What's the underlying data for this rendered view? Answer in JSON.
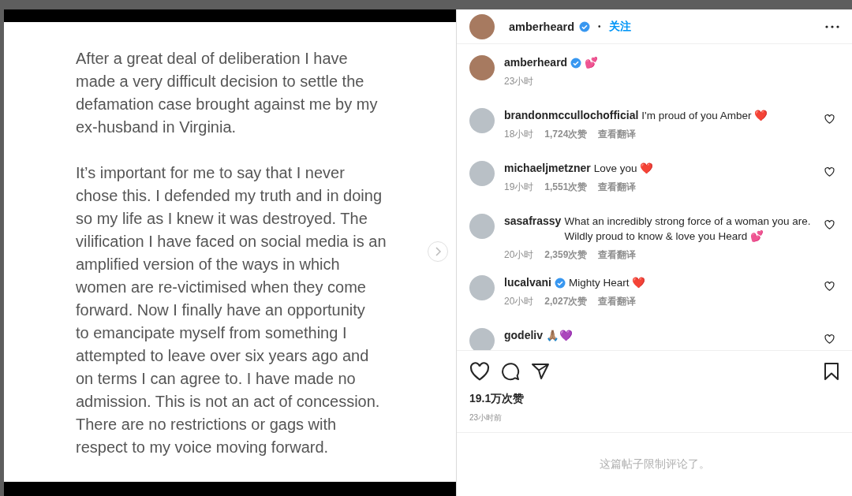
{
  "post_text": [
    "After a great deal of deliberation I have\nmade a very difficult decision to settle the\ndefamation case brought against me by my\nex-husband in Virginia.",
    "It’s important for me to say that I never\nchose this. I defended my truth and in doing\nso my life as I knew it was destroyed. The\nvilification I have faced on social media is an\namplified version of the ways in which\nwomen are re-victimised when they come\nforward.  Now I finally have an opportunity\nto emancipate myself from something I\nattempted to leave over six years ago and\non terms I can agree to. I have made no\nadmission. This is not an act of concession.\nThere are no restrictions or gags with\nrespect to my voice moving forward."
  ],
  "header": {
    "username": "amberheard",
    "verified": true,
    "separator": "•",
    "follow": "关注"
  },
  "caption": {
    "username": "amberheard",
    "verified": true,
    "emoji": "💕",
    "time": "23小时"
  },
  "comments": [
    {
      "username": "brandonmccullochofficial",
      "verified": false,
      "text": "I'm proud of you Amber ❤️",
      "time": "18小时",
      "likes": "1,724次赞",
      "translate": "查看翻译"
    },
    {
      "username": "michaeljmetzner",
      "verified": false,
      "text": "Love you ❤️",
      "time": "19小时",
      "likes": "1,551次赞",
      "translate": "查看翻译"
    },
    {
      "username": "sasafrassy",
      "verified": false,
      "text": "What an incredibly strong force of a woman you are. Wildly proud to know & love you Heard 💕",
      "time": "20小时",
      "likes": "2,359次赞",
      "translate": "查看翻译"
    },
    {
      "username": "lucalvani",
      "verified": true,
      "text": "Mighty Heart ❤️",
      "time": "20小时",
      "likes": "2,027次赞",
      "translate": "查看翻译"
    },
    {
      "username": "godeliv",
      "verified": false,
      "text": "🙏🏽💜"
    }
  ],
  "likes": "19.1万次赞",
  "posted": "23小时前",
  "comments_notice": "这篇帖子限制评论了。"
}
